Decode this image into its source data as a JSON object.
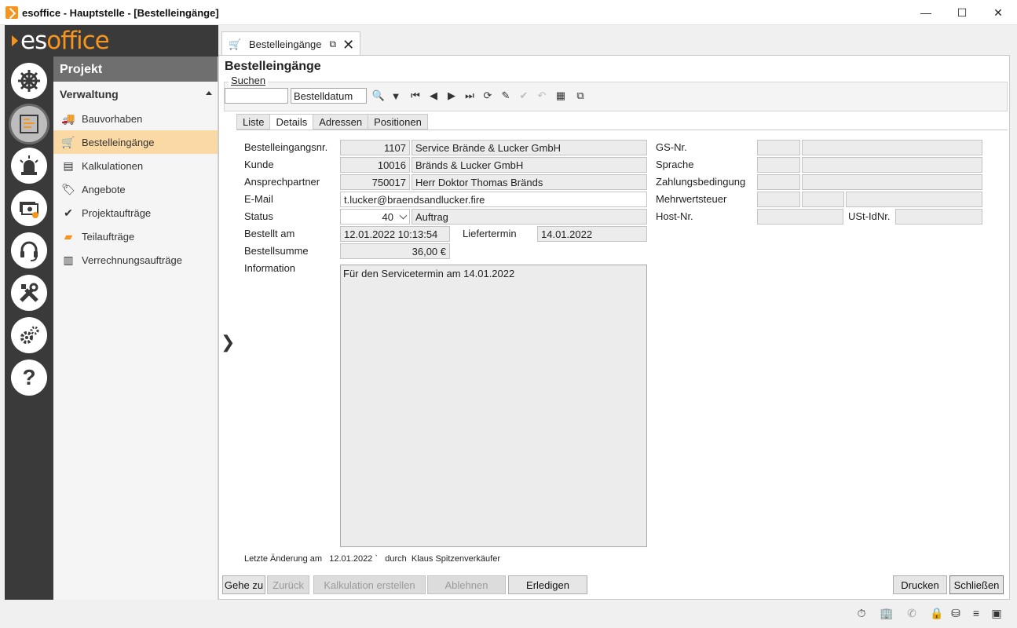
{
  "window": {
    "title": "esoffice - Hauptstelle - [Bestelleingänge]",
    "minimize": "—",
    "maximize": "☐",
    "close": "✕"
  },
  "logo": {
    "part1": "es",
    "part2": "office"
  },
  "nav": {
    "section": "Projekt",
    "group": "Verwaltung",
    "items": [
      {
        "label": "Bauvorhaben",
        "icon": "truck-icon"
      },
      {
        "label": "Bestelleingänge",
        "icon": "cart-icon",
        "selected": true
      },
      {
        "label": "Kalkulationen",
        "icon": "document-icon"
      },
      {
        "label": "Angebote",
        "icon": "tag-icon"
      },
      {
        "label": "Projektaufträge",
        "icon": "check-circle-icon"
      },
      {
        "label": "Teilaufträge",
        "icon": "stack-icon"
      },
      {
        "label": "Verrechnungsaufträge",
        "icon": "invoice-icon"
      }
    ]
  },
  "tab": {
    "label": "Bestelleingänge"
  },
  "panel": {
    "title": "Bestelleingänge"
  },
  "search": {
    "legend": "Suchen",
    "query": "",
    "field": "Bestelldatum"
  },
  "subtabs": [
    "Liste",
    "Details",
    "Adressen",
    "Positionen"
  ],
  "details": {
    "labels": {
      "number": "Bestelleingangsnr.",
      "customer": "Kunde",
      "contact": "Ansprechpartner",
      "email": "E-Mail",
      "status": "Status",
      "ordered_at": "Bestellt am",
      "delivery": "Liefertermin",
      "sum": "Bestellsumme",
      "info": "Information",
      "gs": "GS-Nr.",
      "language": "Sprache",
      "payment": "Zahlungsbedingung",
      "vat": "Mehrwertsteuer",
      "host": "Host-Nr.",
      "ustid": "USt-IdNr."
    },
    "number": "1107",
    "number_text": "Service Brände & Lucker GmbH",
    "customer": "10016",
    "customer_text": "Bränds & Lucker GmbH",
    "contact": "750017",
    "contact_text": "Herr Doktor Thomas Bränds",
    "email": "t.lucker@braendsandlucker.fire",
    "status": "40",
    "status_text": "Auftrag",
    "ordered_at": "12.01.2022 10:13:54",
    "delivery": "14.01.2022",
    "sum": "36,00 €",
    "info": "Für den Servicetermin am 14.01.2022"
  },
  "footer_note": {
    "label": "Letzte Änderung am",
    "date": "12.01.2022",
    "mark": "`",
    "by": "durch",
    "user": "Klaus Spitzenverkäufer"
  },
  "buttons": {
    "goto": "Gehe zu",
    "back": "Zurück",
    "calc": "Kalkulation erstellen",
    "reject": "Ablehnen",
    "done": "Erledigen",
    "print": "Drucken",
    "close": "Schließen"
  }
}
